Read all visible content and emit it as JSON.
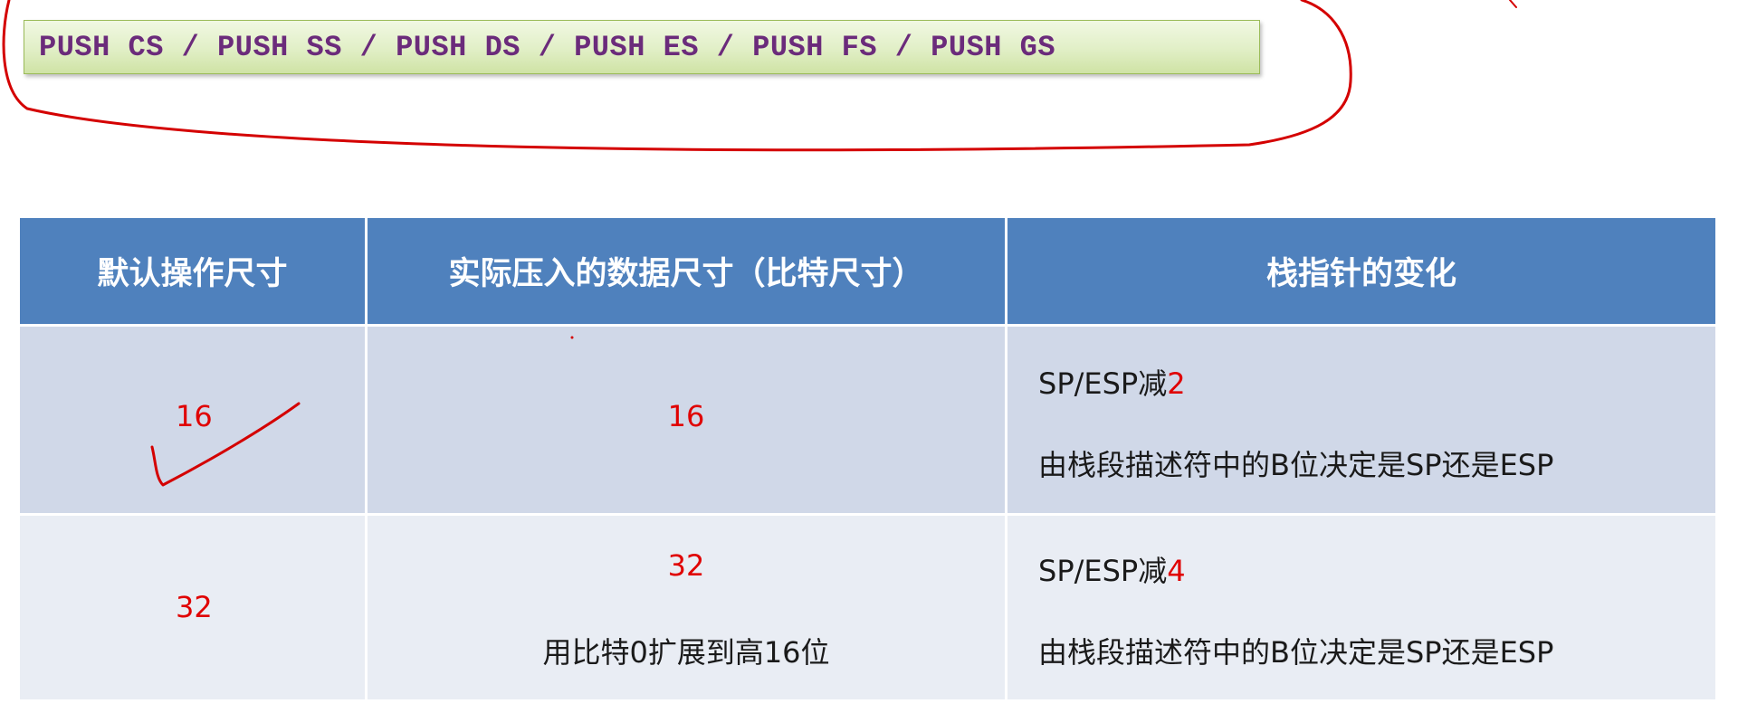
{
  "instruction": "PUSH CS / PUSH SS / PUSH DS / PUSH ES / PUSH FS / PUSH GS",
  "table": {
    "headers": [
      "默认操作尺寸",
      "实际压入的数据尺寸（比特尺寸）",
      "栈指针的变化"
    ],
    "rows": [
      {
        "default_size": "16",
        "actual_size": "16",
        "actual_note": "",
        "sp_change_prefix": "SP/ESP减",
        "sp_change_amount": "2",
        "sp_note": "由栈段描述符中的B位决定是SP还是ESP"
      },
      {
        "default_size": "32",
        "actual_size": "32",
        "actual_note": "用比特0扩展到高16位",
        "sp_change_prefix": "SP/ESP减",
        "sp_change_amount": "4",
        "sp_note": "由栈段描述符中的B位决定是SP还是ESP"
      }
    ]
  },
  "colors": {
    "header_bg": "#4f81bd",
    "row1_bg": "#d0d8e8",
    "row2_bg": "#e9edf4",
    "highlight_red": "#e00000",
    "instruction_text": "#6b2b7b",
    "annotation_ink": "#d40000"
  }
}
